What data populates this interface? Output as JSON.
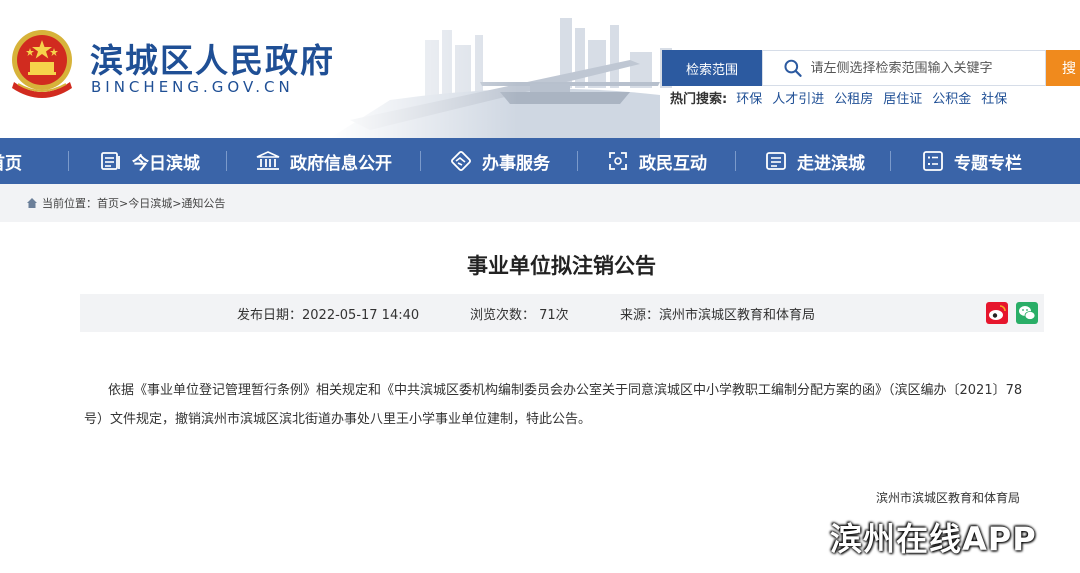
{
  "header": {
    "site_title": "滨城区人民政府",
    "site_domain": "BINCHENG.GOV.CN",
    "search_scope_label": "检索范围",
    "search_placeholder": "请左侧选择检索范围输入关键字",
    "search_button_label": "搜",
    "hot_search_label": "热门搜索:",
    "hot_search_links": [
      "环保",
      "人才引进",
      "公租房",
      "居住证",
      "公积金",
      "社保"
    ]
  },
  "nav": {
    "items": [
      {
        "label": "首页",
        "icon": "home-icon"
      },
      {
        "label": "今日滨城",
        "icon": "news-icon"
      },
      {
        "label": "政府信息公开",
        "icon": "building-icon"
      },
      {
        "label": "办事服务",
        "icon": "handshake-icon"
      },
      {
        "label": "政民互动",
        "icon": "interaction-icon"
      },
      {
        "label": "走进滨城",
        "icon": "document-icon"
      },
      {
        "label": "专题专栏",
        "icon": "list-icon"
      }
    ]
  },
  "breadcrumb": {
    "text": "当前位置：首页>今日滨城>通知公告"
  },
  "article": {
    "title": "事业单位拟注销公告",
    "publish_date": "发布日期：2022-05-17 14:40",
    "views": "浏览次数： 71次",
    "source": "来源：滨州市滨城区教育和体育局",
    "body": "依据《事业单位登记管理暂行条例》相关规定和《中共滨城区委机构编制委员会办公室关于同意滨城区中小学教职工编制分配方案的函》（滨区编办〔2021〕78号）文件规定，撤销滨州市滨城区滨北街道办事处八里王小学事业单位建制，特此公告。",
    "signature": "滨州市滨城区教育和体育局"
  },
  "share": {
    "weibo_icon": "weibo-icon",
    "wechat_icon": "wechat-icon"
  },
  "watermark": "滨州在线APP",
  "colors": {
    "brand_blue": "#1f4f95",
    "nav_blue": "#3a64a8",
    "search_orange": "#f08a1d",
    "gray_bar": "#f2f3f5"
  }
}
